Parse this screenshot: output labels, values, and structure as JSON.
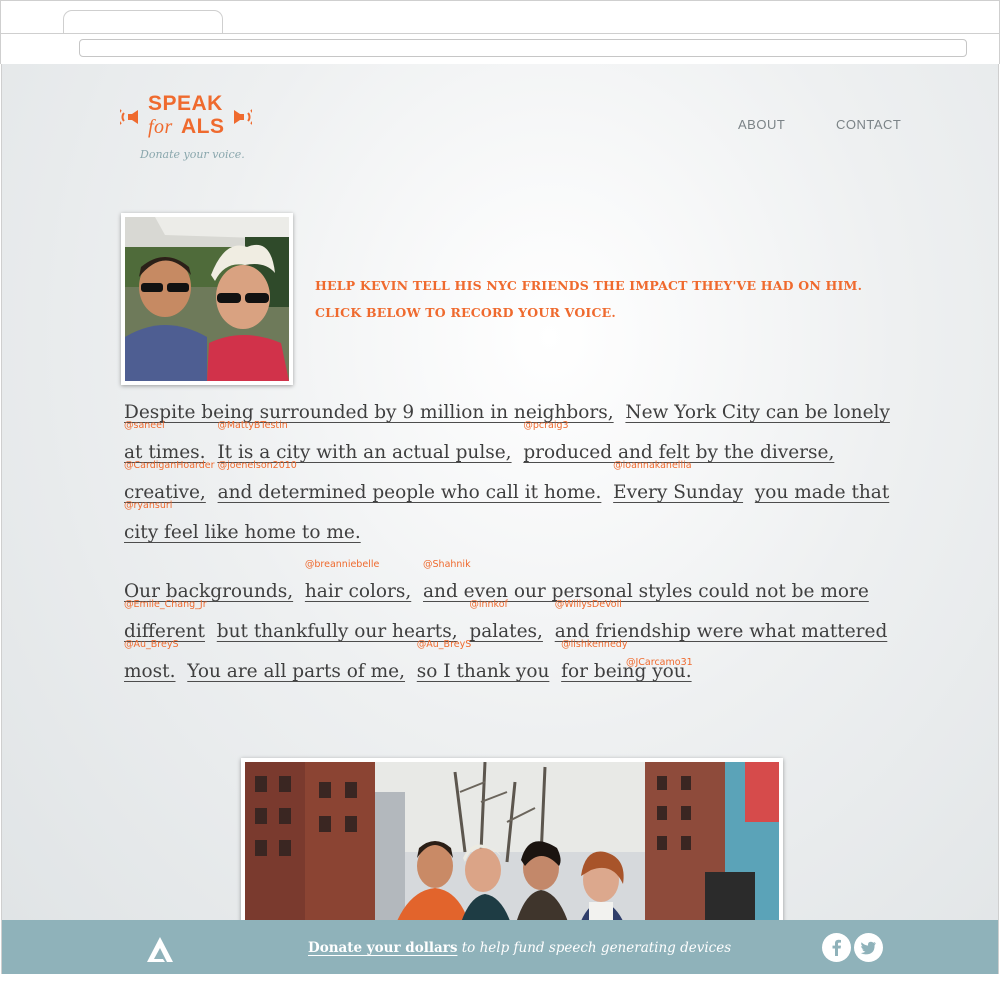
{
  "brand": {
    "logo_line1": "SPEAK",
    "logo_for": "for",
    "logo_als": "ALS",
    "tagline": "Donate your voice.",
    "accent_color": "#ef6a2e",
    "footer_color": "#8fb2ba"
  },
  "nav": {
    "about": "ABOUT",
    "contact": "CONTACT"
  },
  "headline": {
    "line1": "HELP KEVIN TELL HIS NYC FRIENDS THE IMPACT THEY'VE HAD ON HIM.",
    "line2": "CLICK BELOW TO RECORD YOUR VOICE."
  },
  "paragraph1": [
    {
      "segments": [
        {
          "text": "Despite being surrounded by 9 million in neighbors,",
          "tag": ""
        },
        {
          "text": "New York City can be lonely",
          "tag": ""
        }
      ]
    },
    {
      "segments": [
        {
          "text": "at times.",
          "tag": "@saneel"
        },
        {
          "text": "It is a city with an actual pulse,",
          "tag": "@MattyBTestin"
        },
        {
          "text": "produced and felt by the diverse,",
          "tag": "@pcraig3"
        }
      ]
    },
    {
      "segments": [
        {
          "text": "creative,",
          "tag": "@CardiganHoarder"
        },
        {
          "text": "and determined people who call it home.",
          "tag": "@joenelson2010"
        },
        {
          "text": "Every Sunday",
          "tag": "@ioannakanellia"
        },
        {
          "text": "you made that",
          "tag": ""
        }
      ]
    },
    {
      "segments": [
        {
          "text": "city feel like home to me.",
          "tag": "@ryansurl"
        }
      ]
    }
  ],
  "paragraph2": [
    {
      "segments": [
        {
          "text": "Our backgrounds,",
          "tag": ""
        },
        {
          "text": "hair colors,",
          "tag": "@breanniebelle"
        },
        {
          "text": "and even our personal styles could not be more",
          "tag": "@Shahnik"
        }
      ]
    },
    {
      "segments": [
        {
          "text": "different",
          "tag": "@Emile_Chang_Jr"
        },
        {
          "text": "but thankfully our hearts,",
          "tag": ""
        },
        {
          "text": "palates,",
          "tag": "@innkof"
        },
        {
          "text": "and friendship were what mattered",
          "tag": "@WillysDeVoll"
        }
      ]
    },
    {
      "segments": [
        {
          "text": "most.",
          "tag": "@Au_BreyS"
        },
        {
          "text": "You are all parts of me,",
          "tag": ""
        },
        {
          "text": "so I thank you",
          "tag": "@Au_BreyS"
        },
        {
          "text": "for being you.",
          "tag": "@lishkennedy"
        }
      ]
    }
  ],
  "extra_tag": "@JCarcamo31",
  "footer": {
    "link_text": "Donate your dollars",
    "rest_text": " to help fund speech generating devices",
    "icons": [
      "logo-a-icon",
      "facebook-icon",
      "twitter-icon"
    ]
  }
}
